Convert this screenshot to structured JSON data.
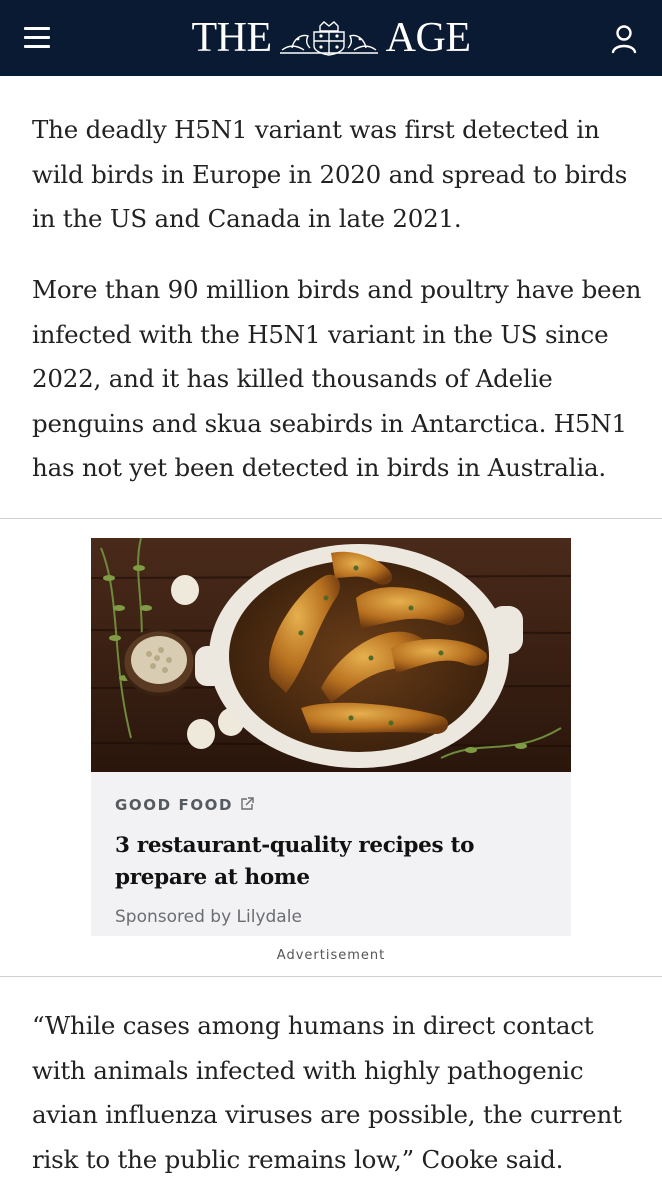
{
  "header": {
    "logo_left": "THE",
    "logo_right": "AGE",
    "background": "#0a1a33",
    "menu_icon": "hamburger-menu-icon",
    "account_icon": "user-account-icon"
  },
  "article": {
    "paragraphs": [
      "The deadly H5N1 variant was first detected in wild birds in Europe in 2020 and spread to birds in the US and Canada in late 2021.",
      "More than 90 million birds and poultry have been infected with the H5N1 variant in the US since 2022, and it has killed thousands of Adelie penguins and skua seabirds in Antarctica. H5N1 has not yet been detected in birds in Australia.",
      "“While cases among humans in direct contact with animals infected with highly pathogenic avian influenza viruses are possible, the current risk to the public remains low,” Cooke said."
    ]
  },
  "advertisement": {
    "brand": "GOOD FOOD",
    "brand_icon": "external-link-icon",
    "headline": "3 restaurant-quality recipes to prepare at home",
    "sponsor": "Sponsored by Lilydale",
    "label": "Advertisement",
    "card_background": "#f2f2f4"
  }
}
